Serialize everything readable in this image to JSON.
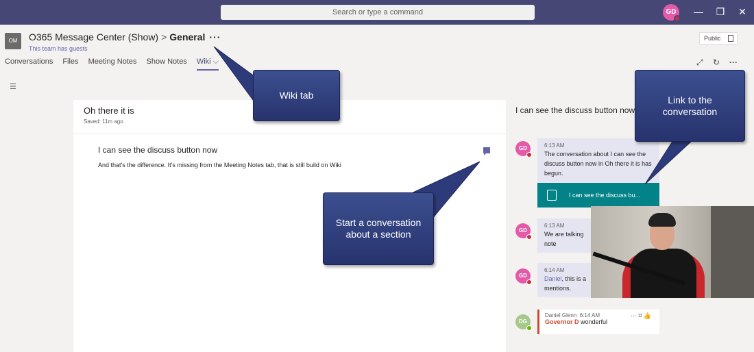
{
  "titlebar": {
    "search_placeholder": "Search or type a command",
    "user_initials": "GD",
    "minimize": "—",
    "maximize": "❐",
    "close": "✕"
  },
  "header": {
    "team_initials": "OM",
    "team_name": "O365 Message Center (Show)",
    "separator": ">",
    "channel": "General",
    "more": "···",
    "guests_note": "This team has guests",
    "visibility": "Public",
    "tabs": [
      {
        "label": "Conversations",
        "active": false
      },
      {
        "label": "Files",
        "active": false
      },
      {
        "label": "Meeting Notes",
        "active": false
      },
      {
        "label": "Show Notes",
        "active": false
      },
      {
        "label": "Wiki ⌵",
        "active": true
      }
    ],
    "add_tab": "+",
    "expand_icon": "⤢",
    "refresh_icon": "↻",
    "more_icon": "···"
  },
  "toc_icon": "☰",
  "wiki": {
    "page_title": "Oh there it is",
    "saved": "Saved: 11m ago",
    "section_title": "I can see the discuss button now",
    "section_body": "And that's the difference. It's missing from the Meeting Notes tab, that is still build on Wiki"
  },
  "conversation": {
    "title": "I can see the discuss button now",
    "messages": [
      {
        "initials": "GD",
        "time": "6:13 AM",
        "text": "The conversation about I can see the discuss button now in Oh there it is has begun."
      },
      {
        "initials": "GD",
        "time": "6:13 AM",
        "text": "We are talking",
        "text2": "note"
      },
      {
        "initials": "GD",
        "time": "6:14 AM",
        "mention": "Daniel",
        "text": ", this is a",
        "text2": "mentions."
      }
    ],
    "card_text": "I can see the discuss bu...",
    "last": {
      "initials": "DG",
      "author": "Daniel Glenn",
      "time": "6:14 AM",
      "mention": "Governor D",
      "text": " wonderful",
      "actions": "··· ⌑ 👍"
    }
  },
  "callouts": {
    "wiki_tab": "Wiki tab",
    "link_conversation": "Link to the conversation",
    "start_conversation": "Start a conversation about a section"
  }
}
